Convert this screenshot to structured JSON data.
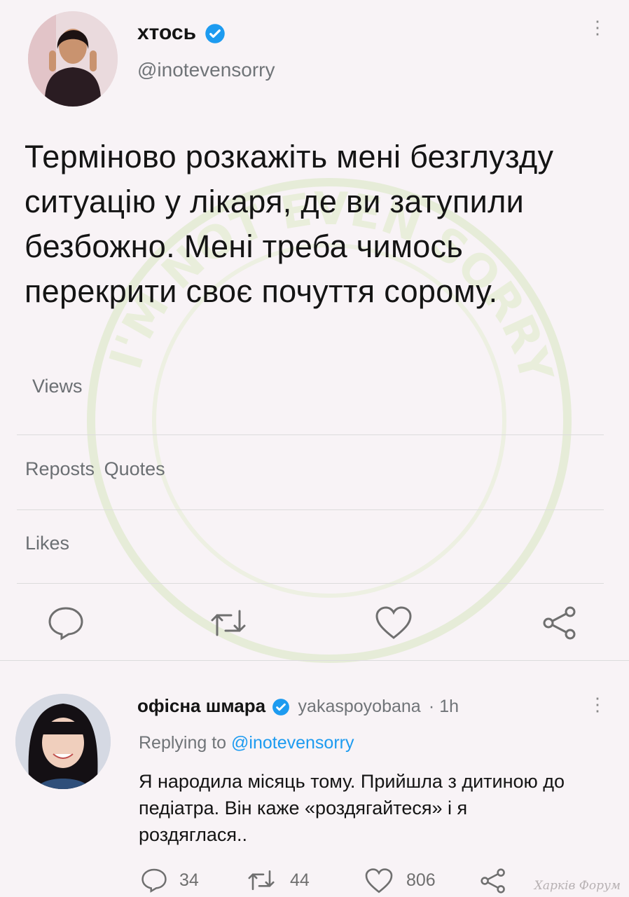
{
  "tweet": {
    "author_name": "хтось",
    "author_handle": "@inotevensorry",
    "text": "Терміново розкажіть мені безглузду ситуацію у лікаря, де ви затупили безбожно. Мені треба чимось перекрити своє почуття сорому.",
    "views_label": "Views",
    "reposts_label": "Reposts",
    "quotes_label": "Quotes",
    "likes_label": "Likes"
  },
  "reply": {
    "author_name": "офісна шмара",
    "author_handle": "yakaspoyobana",
    "time": "· 1h",
    "replying_prefix": "Replying to",
    "replying_handle": "@inotevensorry",
    "text": "Я народила місяць тому. Прийшла з дитиною до педіатра. Він каже «роздягайтеся» і я роздяглася..",
    "reply_count": "34",
    "repost_count": "44",
    "like_count": "806"
  },
  "watermark_text": "I'M NOT EVEN SORRY",
  "forum_credit": "Харків Форум",
  "icons": [
    "verified-badge-icon",
    "more-icon",
    "reply-icon",
    "repost-icon",
    "like-icon",
    "share-icon"
  ],
  "colors": {
    "verified": "#1d9bf0",
    "background": "#f8f3f6",
    "secondary_text": "#707478"
  }
}
